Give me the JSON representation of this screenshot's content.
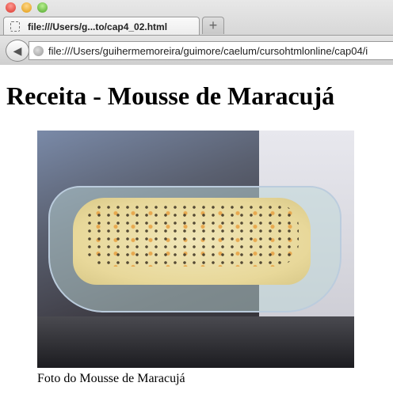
{
  "browser": {
    "tab_title": "file:///Users/g...to/cap4_02.html",
    "new_tab_label": "+",
    "back_label": "◀",
    "url": "file:///Users/guihermemoreira/guimore/caelum/cursohtmlonline/cap04/i",
    "colors": {
      "close": "#ee5c55",
      "minimize": "#f5b43a",
      "zoom": "#7cc44f"
    }
  },
  "page": {
    "heading": "Receita - Mousse de Maracujá",
    "caption": "Foto do Mousse de Maracujá"
  }
}
